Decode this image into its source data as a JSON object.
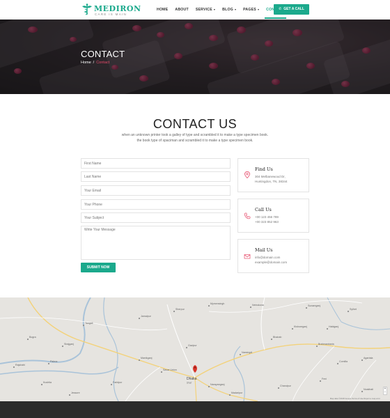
{
  "brand": {
    "name": "MEDIRON",
    "tagline": "CARE IS MAIN",
    "accent": "#1ba98c",
    "highlight": "#e64a6a"
  },
  "nav": {
    "items": [
      {
        "label": "HOME",
        "has_caret": false,
        "active": false
      },
      {
        "label": "ABOUT",
        "has_caret": false,
        "active": false
      },
      {
        "label": "SERVICE",
        "has_caret": true,
        "active": false
      },
      {
        "label": "BLOG",
        "has_caret": true,
        "active": false
      },
      {
        "label": "PAGES",
        "has_caret": true,
        "active": false
      },
      {
        "label": "CONTACT",
        "has_caret": false,
        "active": true
      }
    ],
    "call_label": "GET A CALL"
  },
  "banner": {
    "title": "CONTACT",
    "breadcrumb": {
      "home": "Home",
      "separator": "/",
      "current": "Contact"
    }
  },
  "contact": {
    "title": "CONTACT US",
    "intro_line1": "when an unknown printer took a galley of type and scrambled it to make a type specimen book.",
    "intro_line2": "the book type of spaciman and scrambled it to make a type specimen book.",
    "form": {
      "first_name_placeholder": "First Name",
      "last_name_placeholder": "Last Name",
      "email_placeholder": "Your Email",
      "phone_placeholder": "Your Phone",
      "subject_placeholder": "Your Subject",
      "message_placeholder": "Write Your Message",
      "submit_label": "SUBMIT NOW"
    },
    "cards": {
      "find": {
        "icon": "map-pin-icon",
        "title": "Find Us",
        "line1": "304 Melbanewood Dr,",
        "line2": "Huntingdon, TN, 38344"
      },
      "call": {
        "icon": "phone-icon",
        "title": "Call Us",
        "line1": "+00 123 456 789",
        "line2": "+00 323 852 963"
      },
      "mail": {
        "icon": "mail-icon",
        "title": "Mail Us",
        "line1": "info@domain.com",
        "line2": "example@domain.com"
      }
    }
  },
  "map": {
    "city_label": "Dhaka",
    "city_sub": "ঢাকা",
    "places": [
      "Mymensingh",
      "Netrokona",
      "Tangail",
      "Sirajganj",
      "Pabna",
      "Savar Union",
      "Gazipur",
      "Narsingdi",
      "Brahmanbaria",
      "Comilla",
      "Agartala",
      "Narayanganj",
      "Kishoreganj",
      "Bhairab",
      "Jamalpur",
      "Sherpur",
      "Bogra",
      "Rajshahi",
      "Kushtia",
      "Faridpur",
      "Sylhet",
      "Habiganj",
      "Sunamganj",
      "Manikganj",
      "Madaripur",
      "Chandpur",
      "Feni",
      "Noakhali",
      "Jessore"
    ],
    "footer_text": "Map data ©2018 Google  Terms of Use  Report a map error"
  }
}
